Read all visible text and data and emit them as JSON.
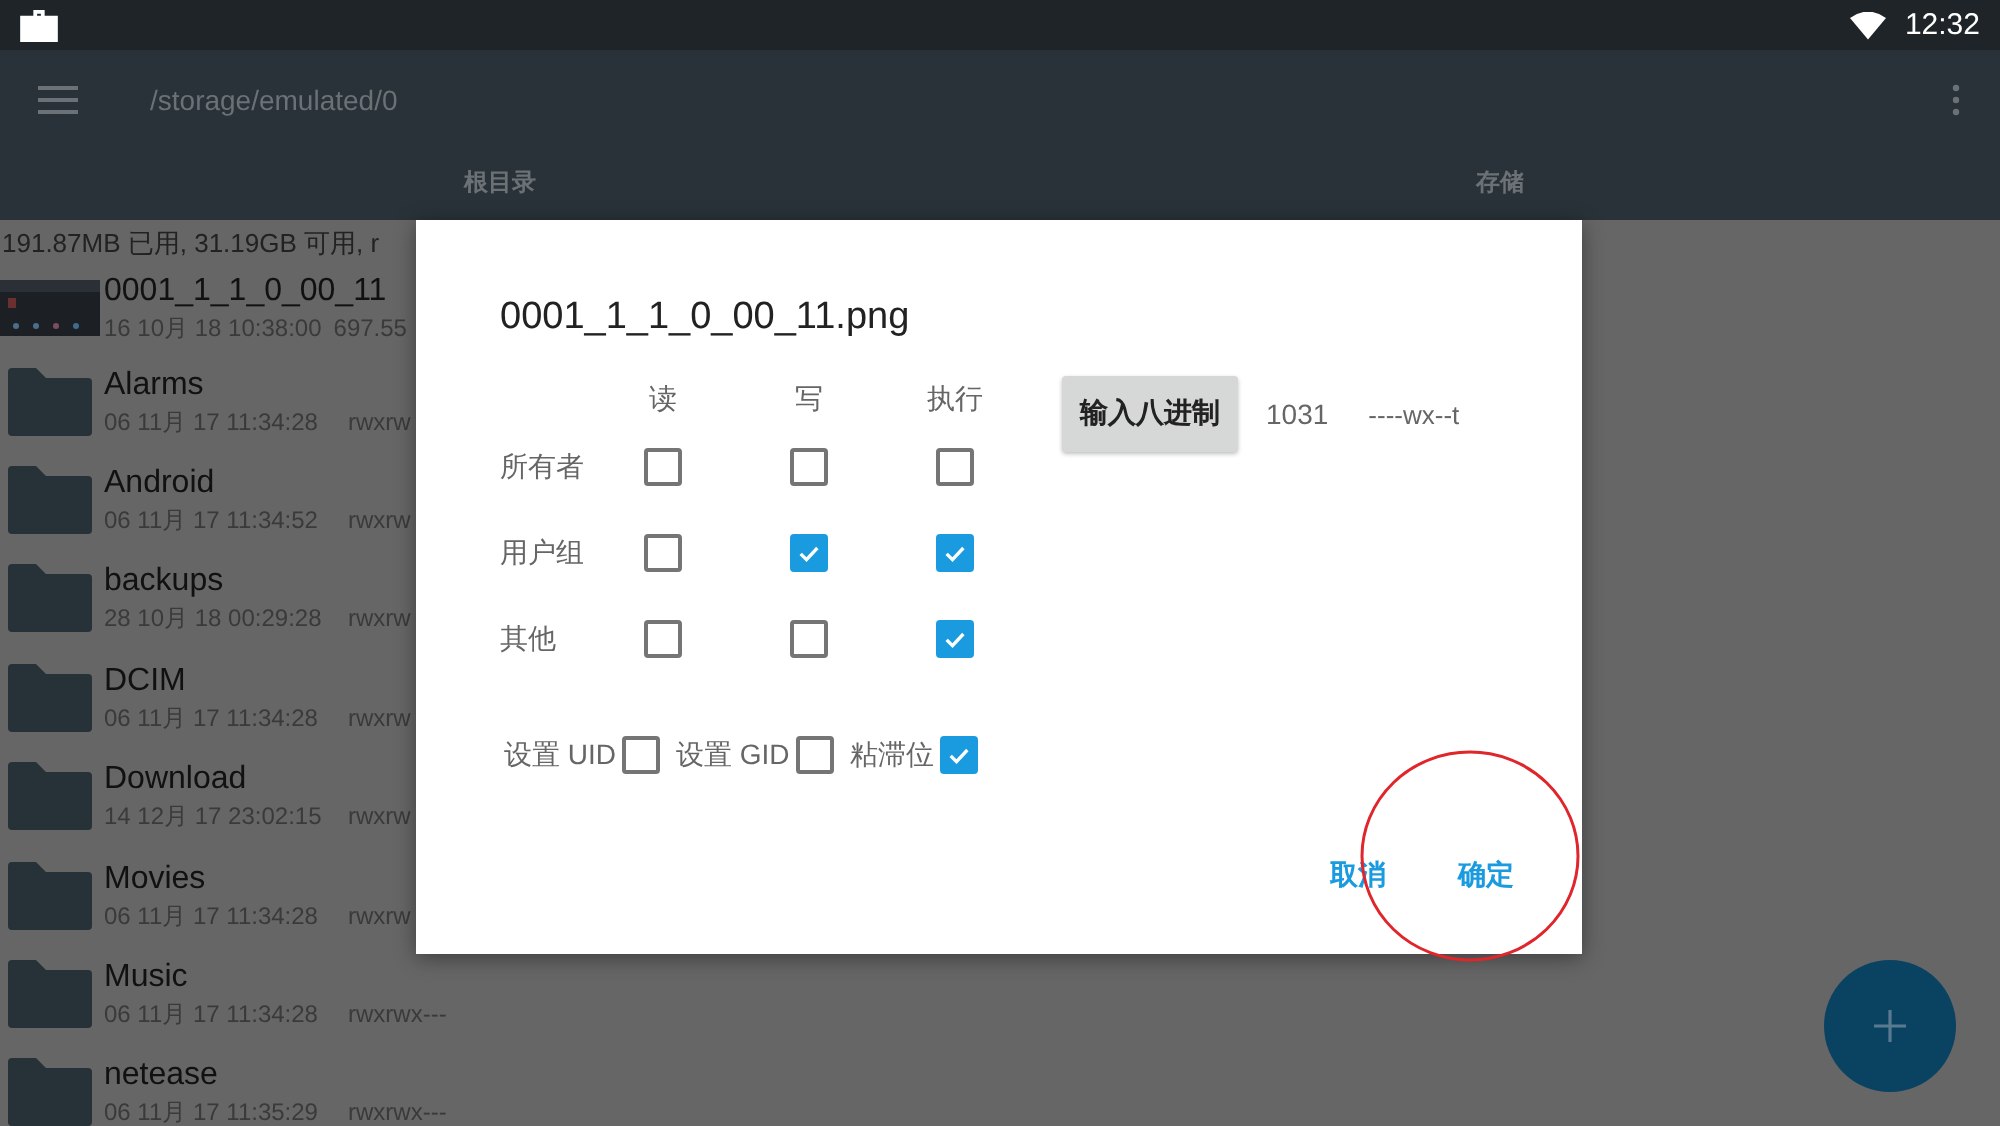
{
  "status_bar": {
    "time": "12:32"
  },
  "toolbar": {
    "path": "/storage/emulated/0"
  },
  "tabs": [
    {
      "label": "根目录",
      "selected": false
    },
    {
      "label": "存储",
      "selected": false
    }
  ],
  "storage_summary": "191.87MB 已用, 31.19GB 可用, r",
  "files": [
    {
      "name": "0001_1_1_0_00_11",
      "date": "16 10月 18 10:38:00",
      "size": "697.55"
    },
    {
      "kind": "folder",
      "name": "Alarms",
      "date": "06 11月 17 11:34:28",
      "permissions": "rwxrw"
    },
    {
      "kind": "folder",
      "name": "Android",
      "date": "06 11月 17 11:34:52",
      "permissions": "rwxrw"
    },
    {
      "kind": "folder",
      "name": "backups",
      "date": "28 10月 18 00:29:28",
      "permissions": "rwxrw"
    },
    {
      "kind": "folder",
      "name": "DCIM",
      "date": "06 11月 17 11:34:28",
      "permissions": "rwxrw"
    },
    {
      "kind": "folder",
      "name": "Download",
      "date": "14 12月 17 23:02:15",
      "permissions": "rwxrw"
    },
    {
      "kind": "folder",
      "name": "Movies",
      "date": "06 11月 17 11:34:28",
      "permissions": "rwxrw"
    },
    {
      "kind": "folder",
      "name": "Music",
      "date": "06 11月 17 11:34:28",
      "permissions": "rwxrwx---"
    },
    {
      "kind": "folder",
      "name": "netease",
      "date": "06 11月 17 11:35:29",
      "permissions": "rwxrwx---"
    }
  ],
  "dialog": {
    "title": "0001_1_1_0_00_11.png",
    "columns": [
      "读",
      "写",
      "执行"
    ],
    "rows": [
      {
        "label": "所有者",
        "checks": [
          {
            "checked": false
          },
          {
            "checked": false
          },
          {
            "checked": false
          }
        ]
      },
      {
        "label": "用户组",
        "checks": [
          {
            "checked": false
          },
          {
            "checked": true
          },
          {
            "checked": true
          }
        ]
      },
      {
        "label": "其他",
        "checks": [
          {
            "checked": false
          },
          {
            "checked": false
          },
          {
            "checked": true
          }
        ]
      }
    ],
    "special": [
      {
        "label": "设置 UID",
        "checked": false
      },
      {
        "label": "设置 GID",
        "checked": false
      },
      {
        "label": "粘滞位",
        "checked": true
      }
    ],
    "octal_button": "输入八进制",
    "octal_value": "1031",
    "symbolic": "----wx--t",
    "buttons": [
      "取消",
      "确定"
    ]
  }
}
